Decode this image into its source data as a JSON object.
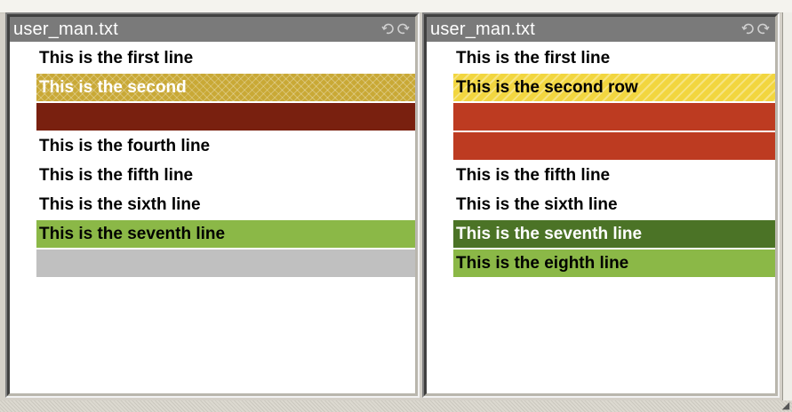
{
  "colors": {
    "title_bar": "#7a7a7a",
    "gold_hatch": "#c9a936",
    "yellow_hatch": "#f2d63f",
    "maroon": "#79200f",
    "rust": "#bd3b21",
    "green_light": "#8bb847",
    "green_dark": "#4b7326",
    "grey": "#c0c0c0"
  },
  "left_pane": {
    "title": "user_man.txt",
    "icons": [
      "undo-icon",
      "redo-icon"
    ],
    "rows": [
      {
        "text": "This is the first line",
        "style": "plain"
      },
      {
        "text": "This is the second",
        "style": "hatch-gold"
      },
      {
        "text": "",
        "style": "maroon"
      },
      {
        "text": "This is the fourth line",
        "style": "plain"
      },
      {
        "text": "This is the fifth line",
        "style": "plain"
      },
      {
        "text": "This is the sixth line",
        "style": "plain"
      },
      {
        "text": "This is the seventh line",
        "style": "green-light"
      },
      {
        "text": "",
        "style": "grey"
      }
    ]
  },
  "right_pane": {
    "title": "user_man.txt",
    "icons": [
      "undo-icon",
      "redo-icon"
    ],
    "rows": [
      {
        "text": "This is the first line",
        "style": "plain"
      },
      {
        "text": "This is the second row",
        "style": "hatch-yellow"
      },
      {
        "text": "",
        "style": "rust"
      },
      {
        "text": "",
        "style": "rust"
      },
      {
        "text": "This is the fifth line",
        "style": "plain"
      },
      {
        "text": "This is the sixth line",
        "style": "plain"
      },
      {
        "text": "This is the seventh line",
        "style": "green-dark"
      },
      {
        "text": "This is the eighth line",
        "style": "green-light"
      }
    ]
  }
}
